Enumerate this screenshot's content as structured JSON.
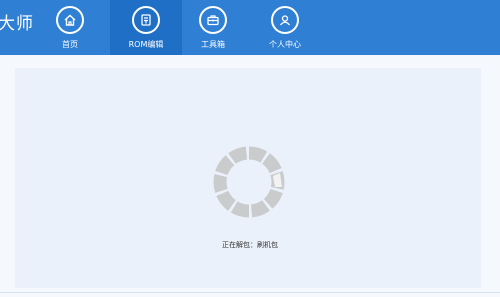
{
  "app": {
    "logo_text": "大师"
  },
  "nav": {
    "items": [
      {
        "label": "首页",
        "icon": "home-icon"
      },
      {
        "label": "ROM编辑",
        "icon": "rom-edit-icon",
        "active": true
      },
      {
        "label": "工具箱",
        "icon": "toolbox-icon"
      },
      {
        "label": "个人中心",
        "icon": "user-icon"
      }
    ]
  },
  "main": {
    "status_text": "正在解包：刷机包"
  },
  "colors": {
    "topbar": "#2f7fd4",
    "active_tab": "#1f6fc6",
    "panel": "#eaf1fa",
    "spinner": "#c9cbcd"
  }
}
